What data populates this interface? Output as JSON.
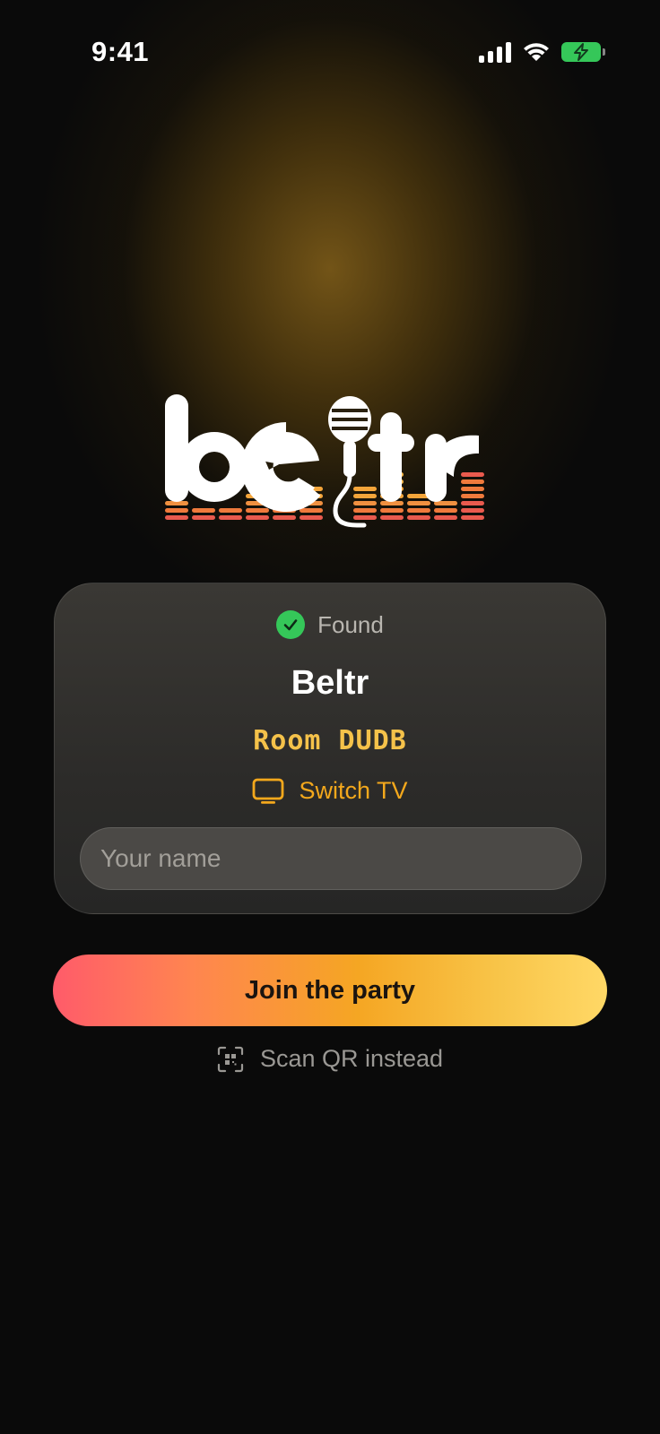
{
  "status_bar": {
    "time": "9:41",
    "icons": [
      "signal-icon",
      "wifi-icon",
      "battery-charging-icon"
    ],
    "battery_color": "#35c759"
  },
  "logo": {
    "text": "beltr",
    "icon": "microphone-icon",
    "colors": [
      "#ffffff",
      "#f4a53a",
      "#ef7a3c",
      "#e95a4e"
    ]
  },
  "card": {
    "status_label": "Found",
    "status_icon": "check-circle-icon",
    "tv_name": "Beltr",
    "room_code": "Room DUDB",
    "switch_label": "Switch TV",
    "switch_icon": "tv-icon",
    "name_input": {
      "placeholder": "Your name",
      "value": ""
    }
  },
  "actions": {
    "join_label": "Join the party",
    "scan_label": "Scan QR instead",
    "scan_icon": "qr-scan-icon"
  },
  "colors": {
    "accent": "#f4a81c",
    "room_code": "#f5c24a",
    "success": "#35c759",
    "background": "#0a0a0a"
  }
}
